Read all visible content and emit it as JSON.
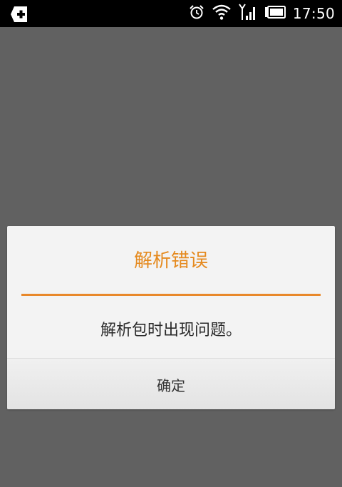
{
  "status_bar": {
    "time": "17:50",
    "icons": [
      "app-plus-icon",
      "alarm-clock-icon",
      "wifi-icon",
      "signal-icon",
      "battery-icon"
    ]
  },
  "dialog": {
    "title": "解析错误",
    "message": "解析包时出现问题。",
    "confirm_label": "确定"
  },
  "colors": {
    "accent": "#e58a1f",
    "divider": "#e8882a",
    "backdrop": "#616161",
    "status_bar": "#000000",
    "dialog_bg": "#f3f3f3"
  }
}
